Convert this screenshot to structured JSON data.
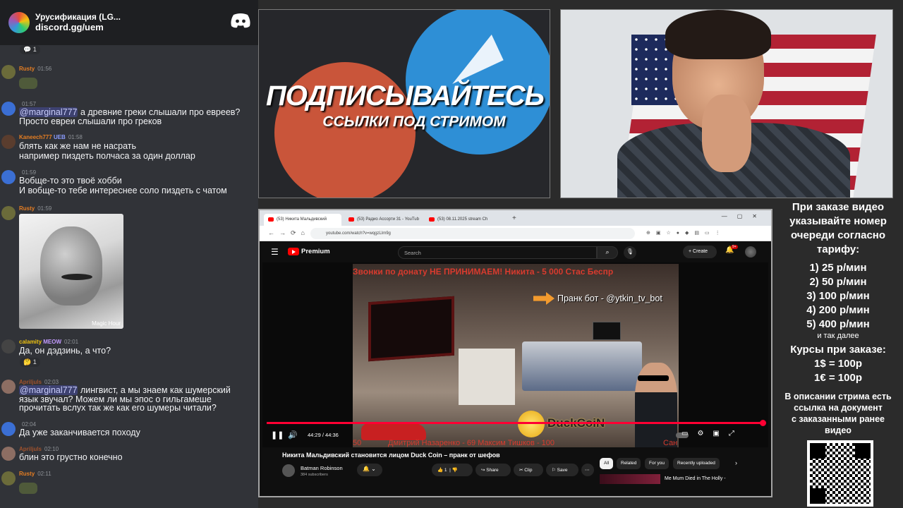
{
  "chat": {
    "server_name": "Урусификация (LG...",
    "server_link": "discord.gg/uem",
    "messages": [
      {
        "user": "Rusty",
        "time": "01:56"
      },
      {
        "user": "",
        "time": "01:57",
        "mention": "@marginal777",
        "lines": [
          "а древние греки слышали про евреев?",
          "Просто евреи слышали про греков"
        ]
      },
      {
        "user": "Kaneech777",
        "badge": "UEB",
        "time": "01:58",
        "lines": [
          "блять как же нам не насрать",
          "например пиздеть полчаса за один доллар"
        ]
      },
      {
        "user": "",
        "time": "01:59",
        "lines": [
          "Вобще-то это твоё хобби",
          "И вобще-то тебе интереснее соло пиздеть с чатом"
        ]
      },
      {
        "user": "Rusty",
        "time": "01:59",
        "image_watermark": "Magic Hour"
      },
      {
        "user": "calamity",
        "badge": "MEOW",
        "time": "02:01",
        "lines": [
          "Да, он дэдзинь, а что?"
        ],
        "reaction_count": "1"
      },
      {
        "user": "Apriljuls",
        "time": "02:03",
        "mention": "@marginal777",
        "lines": [
          "лингвист, а мы знаем как шумерский",
          "язык звучал? Можем ли мы эпос о гильгамеше",
          "прочитать вслух так же как его шумеры читали?"
        ]
      },
      {
        "user": "",
        "time": "02:04",
        "lines": [
          "Да уже заканчивается походу"
        ]
      },
      {
        "user": "Apriljuls",
        "time": "02:10",
        "lines": [
          "блин это грустно конечно"
        ]
      },
      {
        "user": "Rusty",
        "time": "02:11"
      }
    ],
    "top_reaction_count": "1"
  },
  "promo": {
    "title": "ПОДПИСЫВАЙТЕСЬ",
    "subtitle": "ССЫЛКИ ПОД СТРИМОМ"
  },
  "browser": {
    "tabs": [
      "(53) Никита Мальдивский",
      "(53) Радио Ассорти 31 - YouTub",
      "(53) 08.11.2025 stream Ch"
    ],
    "url": "youtube.com/watch?v=wqgzLlm9g",
    "yt_brand": "Premium",
    "search_placeholder": "Search",
    "create_label": "Create",
    "notif_count": "9+",
    "video": {
      "ticker_top": "Звонки по донату НЕ ПРИНИМАЕМ!     Никита - 5 000      Стас Беспр",
      "prank_text": "Пранк бот - @ytkin_tv_bot",
      "duck_text": "DuckCoiN",
      "ticker_bottom": "Дмитрий Назаренко - 69          Максим Тишков - 100",
      "ticker_bottom_left": "50",
      "ticker_bottom_right": "Сан",
      "time": "44:29 / 44:36",
      "progress": 0.998
    },
    "video_title": "Никита Мальдивский становится лицом Duck Coin – пранк от шефов",
    "channel_name": "Batman Robinson",
    "channel_subs": "384 subscribers",
    "like_count": "1",
    "share_label": "Share",
    "clip_label": "Clip",
    "save_label": "Save",
    "chips": [
      "All",
      "Related",
      "For you",
      "Recently uploaded"
    ],
    "rec_title": "Me Mum Died in The Holly -"
  },
  "info": {
    "intro": [
      "При заказе видео",
      "указывайте номер",
      "очереди согласно",
      "тарифу:"
    ],
    "prices": [
      "1) 25 р/мин",
      "2) 50 р/мин",
      "3) 100 р/мин",
      "4) 200 р/мин",
      "5) 400 р/мин"
    ],
    "etc": "и так далее",
    "courses": [
      "Курсы при заказе:",
      "1$ = 100р",
      "1€ = 100р"
    ],
    "desc": [
      "В описании стрима есть",
      "ссылка на документ",
      "с заказанными ранее",
      "видео"
    ]
  }
}
